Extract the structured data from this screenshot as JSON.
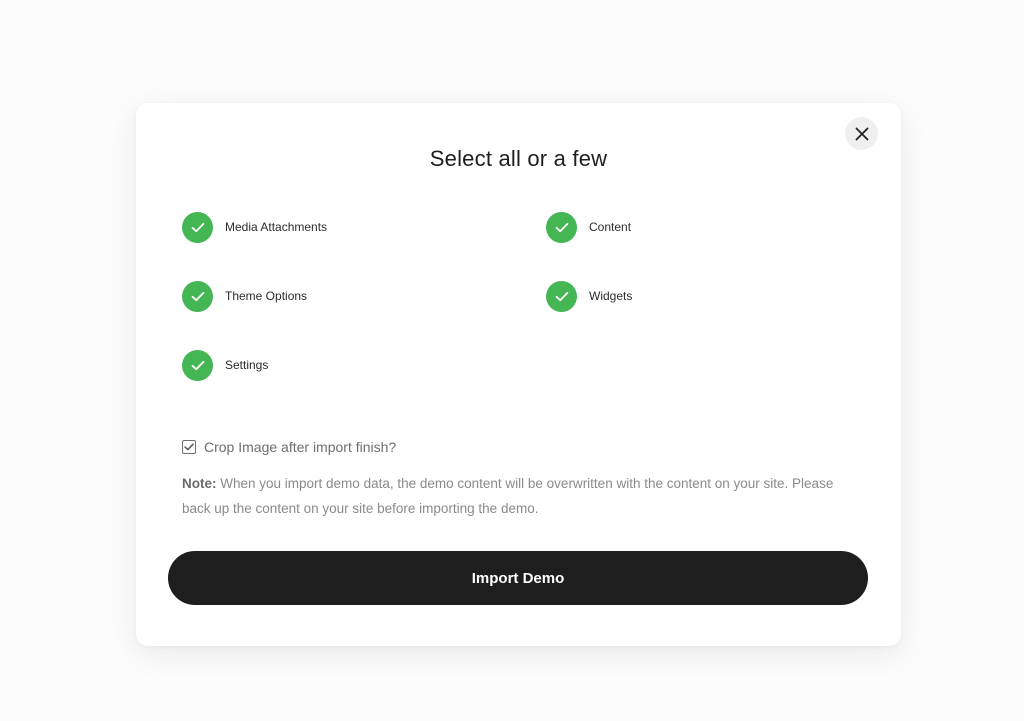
{
  "modal": {
    "title": "Select all or a few",
    "close_icon": "close-icon",
    "options": [
      {
        "label": "Media Attachments",
        "checked": true
      },
      {
        "label": "Content",
        "checked": true
      },
      {
        "label": "Theme Options",
        "checked": true
      },
      {
        "label": "Widgets",
        "checked": true
      },
      {
        "label": "Settings",
        "checked": true
      }
    ],
    "crop": {
      "label": "Crop Image after import finish?",
      "checked": true
    },
    "note": {
      "prefix": "Note:",
      "text": " When you import demo data, the demo content will be overwritten with the content on your site. Please back up the content on your site before importing the demo."
    },
    "import_button": "Import Demo"
  },
  "colors": {
    "accent_green": "#44b654",
    "button_dark": "#1e1e1e"
  }
}
